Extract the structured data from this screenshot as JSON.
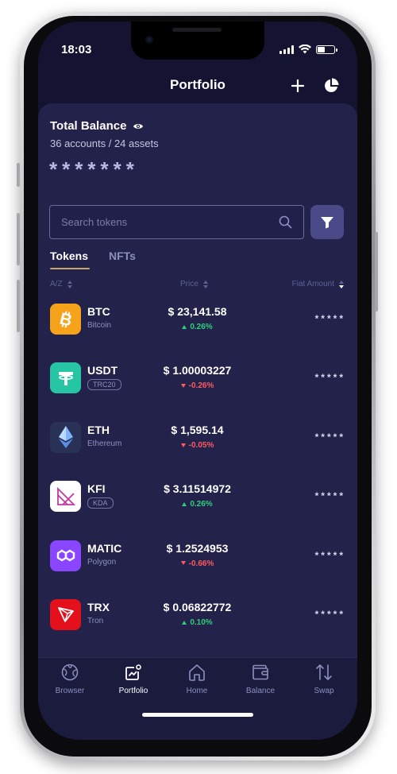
{
  "status_bar": {
    "time": "18:03"
  },
  "header": {
    "title": "Portfolio",
    "add_icon": "plus-icon",
    "chart_icon": "pie-chart-icon"
  },
  "balance": {
    "title": "Total Balance",
    "visibility_icon": "eye-icon",
    "accounts": "36 accounts / 24 assets",
    "masked_value": "*******"
  },
  "search": {
    "placeholder": "Search tokens",
    "search_icon": "search-icon",
    "filter_icon": "filter-icon"
  },
  "tabs": [
    {
      "label": "Tokens",
      "active": true
    },
    {
      "label": "NFTs",
      "active": false
    }
  ],
  "columns": {
    "name": "A/Z",
    "price": "Price",
    "fiat": "Fiat Amount"
  },
  "tokens": [
    {
      "symbol": "BTC",
      "name": "Bitcoin",
      "network": null,
      "price": "$ 23,141.58",
      "change": "0.26%",
      "direction": "up",
      "fiat": "*****",
      "color": "#f7a21b",
      "icon": "bitcoin-icon"
    },
    {
      "symbol": "USDT",
      "name": null,
      "network": "TRC20",
      "price": "$ 1.00003227",
      "change": "-0.26%",
      "direction": "down",
      "fiat": "*****",
      "color": "#26c6a4",
      "icon": "tether-icon"
    },
    {
      "symbol": "ETH",
      "name": "Ethereum",
      "network": null,
      "price": "$ 1,595.14",
      "change": "-0.05%",
      "direction": "down",
      "fiat": "*****",
      "color": "#2a3157",
      "icon": "ethereum-icon"
    },
    {
      "symbol": "KFI",
      "name": null,
      "network": "KDA",
      "price": "$ 3.11514972",
      "change": "0.26%",
      "direction": "up",
      "fiat": "*****",
      "color": "#ffffff",
      "icon": "kfi-icon"
    },
    {
      "symbol": "MATIC",
      "name": "Polygon",
      "network": null,
      "price": "$ 1.2524953",
      "change": "-0.66%",
      "direction": "down",
      "fiat": "*****",
      "color": "#8a46ff",
      "icon": "polygon-icon"
    },
    {
      "symbol": "TRX",
      "name": "Tron",
      "network": null,
      "price": "$ 0.06822772",
      "change": "0.10%",
      "direction": "up",
      "fiat": "*****",
      "color": "#e4101b",
      "icon": "tron-icon"
    }
  ],
  "nav": [
    {
      "label": "Browser",
      "icon": "globe-icon",
      "active": false
    },
    {
      "label": "Portfolio",
      "icon": "portfolio-chart-icon",
      "active": true
    },
    {
      "label": "Home",
      "icon": "home-icon",
      "active": false
    },
    {
      "label": "Balance",
      "icon": "wallet-icon",
      "active": false
    },
    {
      "label": "Swap",
      "icon": "swap-arrows-icon",
      "active": false
    }
  ],
  "colors": {
    "background": "#141432",
    "panel": "#22224a",
    "accent": "#c9a46b",
    "up": "#2ecf7a",
    "down": "#ff5a5f"
  }
}
